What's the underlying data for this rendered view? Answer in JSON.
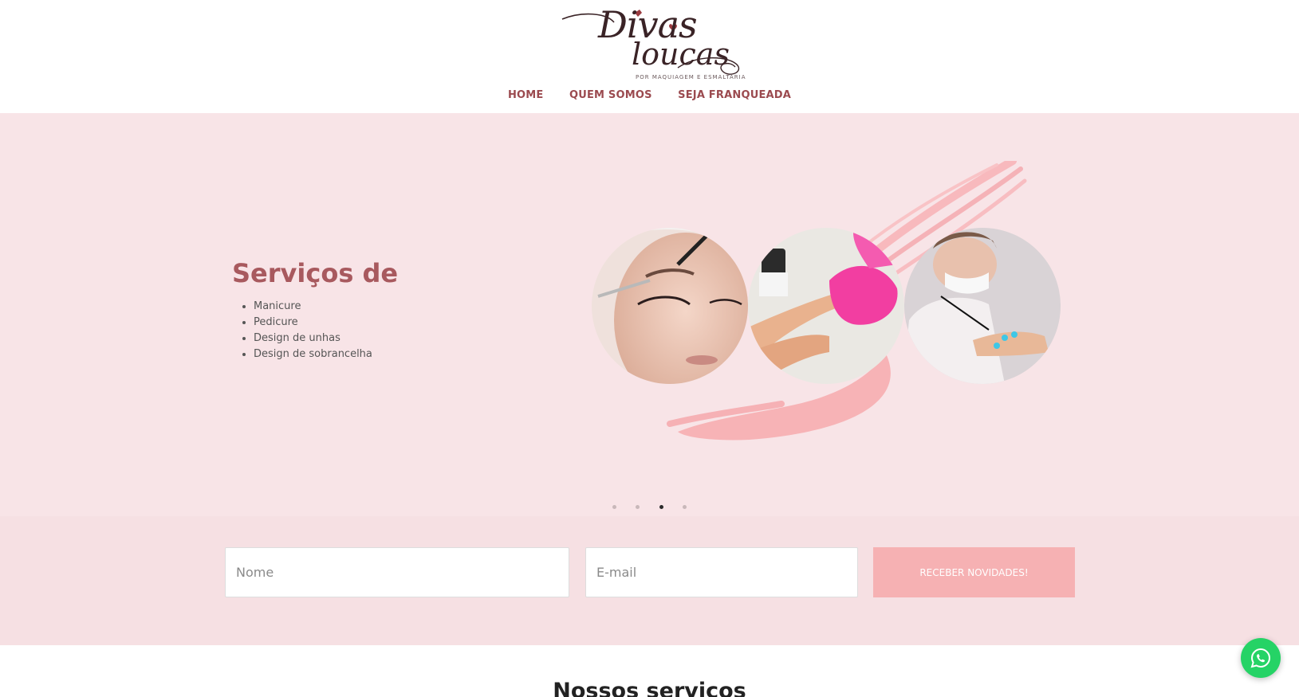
{
  "brand": {
    "line1": "Divas",
    "line2": "loucas",
    "tagline": "POR MAQUIAGEM E ESMALTARIA"
  },
  "nav": {
    "items": [
      {
        "label": "HOME"
      },
      {
        "label": "QUEM SOMOS"
      },
      {
        "label": "SEJA FRANQUEADA"
      }
    ]
  },
  "hero": {
    "title": "Serviços de",
    "services": [
      "Manicure",
      "Pedicure",
      "Design de unhas",
      "Design de sobrancelha"
    ],
    "slides_total": 4,
    "active_slide": 3,
    "images": [
      "eyebrow-design-photo",
      "manicure-photo",
      "nail-design-photo"
    ]
  },
  "newsletter": {
    "name_placeholder": "Nome",
    "email_placeholder": "E-mail",
    "button_label": "RECEBER NOVIDADES!"
  },
  "services_section": {
    "title": "Nossos serviços"
  },
  "floating": {
    "whatsapp_icon": "whatsapp-icon"
  },
  "colors": {
    "accent": "#9b4a4f",
    "hero_bg": "#f8e4e7",
    "button": "#f6b1b3",
    "whatsapp": "#25d366"
  }
}
